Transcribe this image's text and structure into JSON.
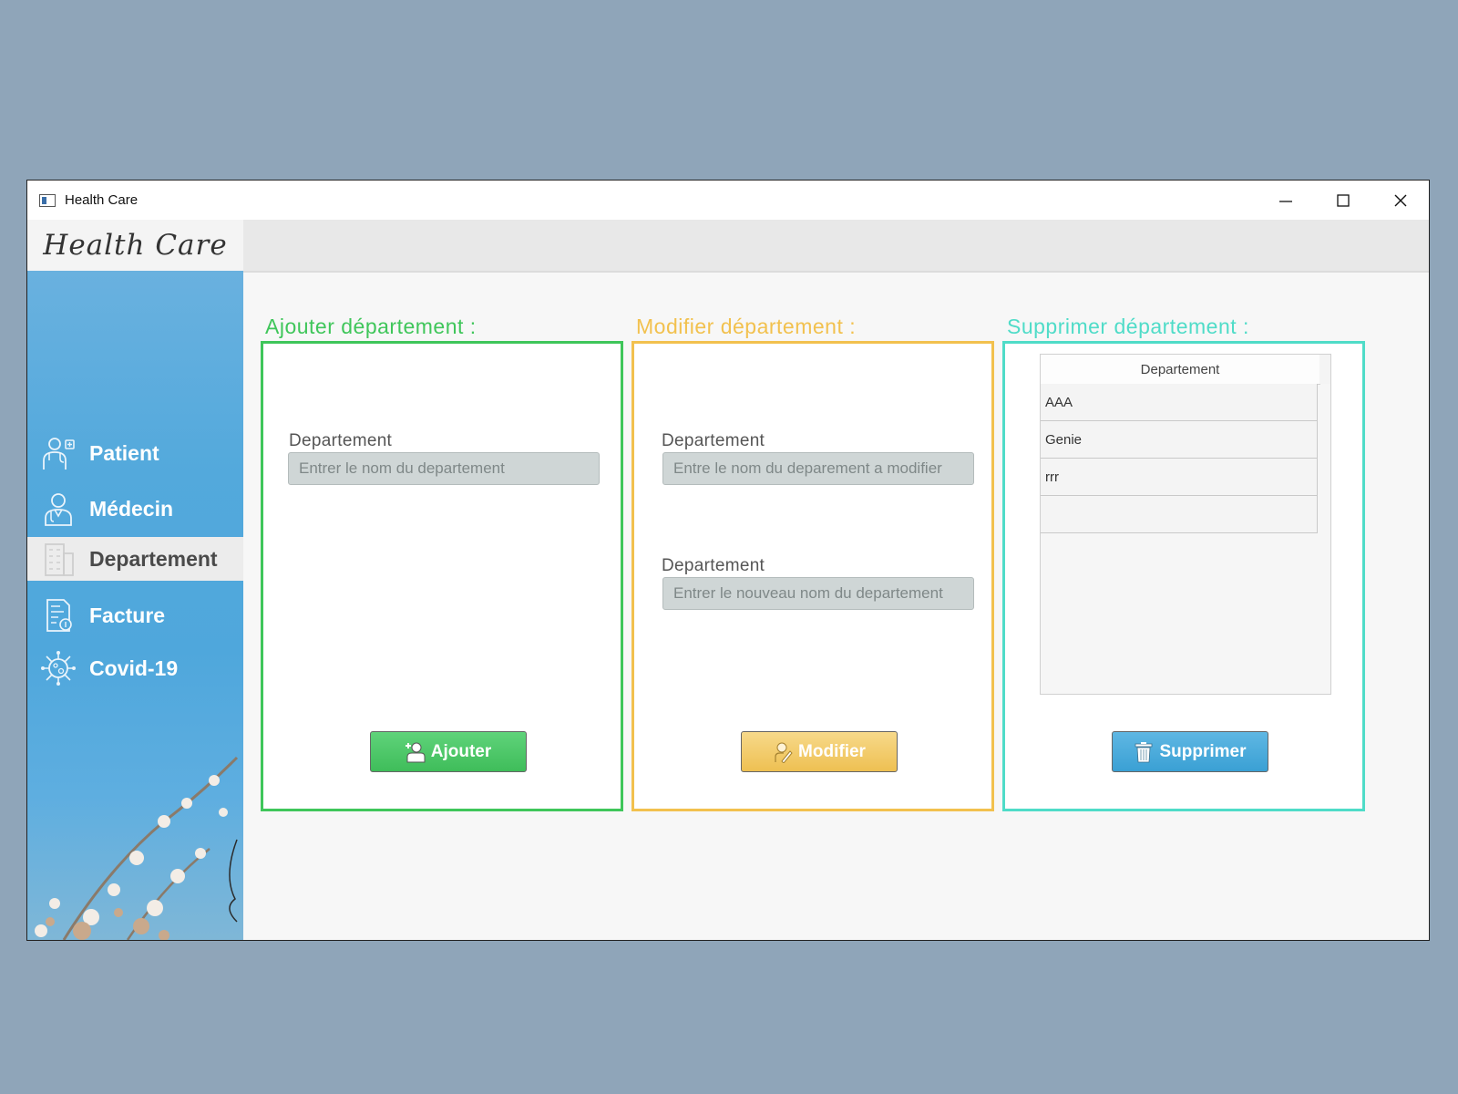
{
  "window": {
    "title": "Health Care"
  },
  "sidebar": {
    "logo": "Health Care",
    "items": [
      {
        "label": "Patient",
        "icon": "doctor-icon"
      },
      {
        "label": "Médecin",
        "icon": "medecin-icon"
      },
      {
        "label": "Departement",
        "icon": "building-icon",
        "active": true
      },
      {
        "label": "Facture",
        "icon": "invoice-icon"
      },
      {
        "label": "Covid-19",
        "icon": "virus-icon"
      }
    ]
  },
  "add_panel": {
    "title": "Ajouter département :",
    "color": "#3fc65a",
    "field_label": "Departement",
    "field_placeholder": "Entrer le nom du departement",
    "button_label": "Ajouter"
  },
  "edit_panel": {
    "title": "Modifier département :",
    "color": "#f2c14e",
    "field1_label": "Departement",
    "field1_placeholder": "Entre le nom du deparement a modifier",
    "field2_label": "Departement",
    "field2_placeholder": "Entrer le nouveau nom du departement",
    "button_label": "Modifier"
  },
  "delete_panel": {
    "title": "Supprimer département :",
    "color": "#4fdcc8",
    "table": {
      "column": "Departement",
      "rows": [
        "AAA",
        "Genie",
        "rrr",
        ""
      ]
    },
    "button_label": "Supprimer"
  }
}
